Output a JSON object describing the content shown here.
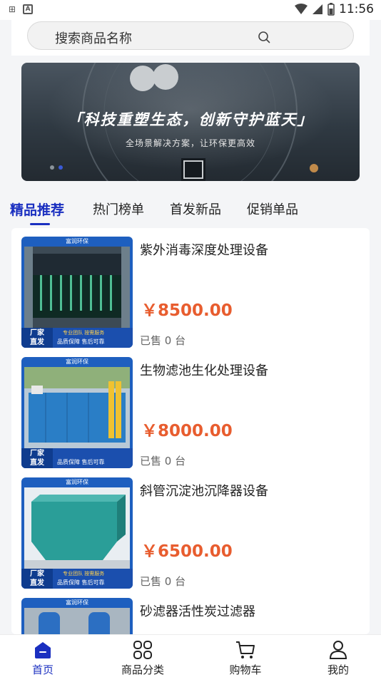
{
  "status_bar": {
    "time": "11:56"
  },
  "search": {
    "placeholder": "搜索商品名称"
  },
  "banner": {
    "title": "「科技重塑生态，创新守护蓝天」",
    "subtitle": "全场景解决方案，让环保更高效"
  },
  "tabs": [
    {
      "label": "精品推荐",
      "active": true
    },
    {
      "label": "热门榜单",
      "active": false
    },
    {
      "label": "首发新品",
      "active": false
    },
    {
      "label": "促销单品",
      "active": false
    }
  ],
  "thumb_overlay": {
    "brand": "富润环保",
    "left_line1": "厂家",
    "left_line2": "直发",
    "tag": "专业团队 按需服务",
    "text": "品质保障 售后可靠"
  },
  "products": [
    {
      "name": "紫外消毒深度处理设备",
      "price": "￥8500.00",
      "sold": "已售 0 台"
    },
    {
      "name": "生物滤池生化处理设备",
      "price": "￥8000.00",
      "sold": "已售 0 台"
    },
    {
      "name": "斜管沉淀池沉降器设备",
      "price": "￥6500.00",
      "sold": "已售 0 台"
    },
    {
      "name": "砂滤器活性炭过滤器",
      "price": "",
      "sold": ""
    }
  ],
  "bottom_nav": [
    {
      "label": "首页",
      "icon": "home-icon",
      "active": true
    },
    {
      "label": "商品分类",
      "icon": "category-icon",
      "active": false
    },
    {
      "label": "购物车",
      "icon": "cart-icon",
      "active": false
    },
    {
      "label": "我的",
      "icon": "user-icon",
      "active": false
    }
  ],
  "colors": {
    "accent": "#1a2fc0",
    "price": "#e85d2f"
  }
}
